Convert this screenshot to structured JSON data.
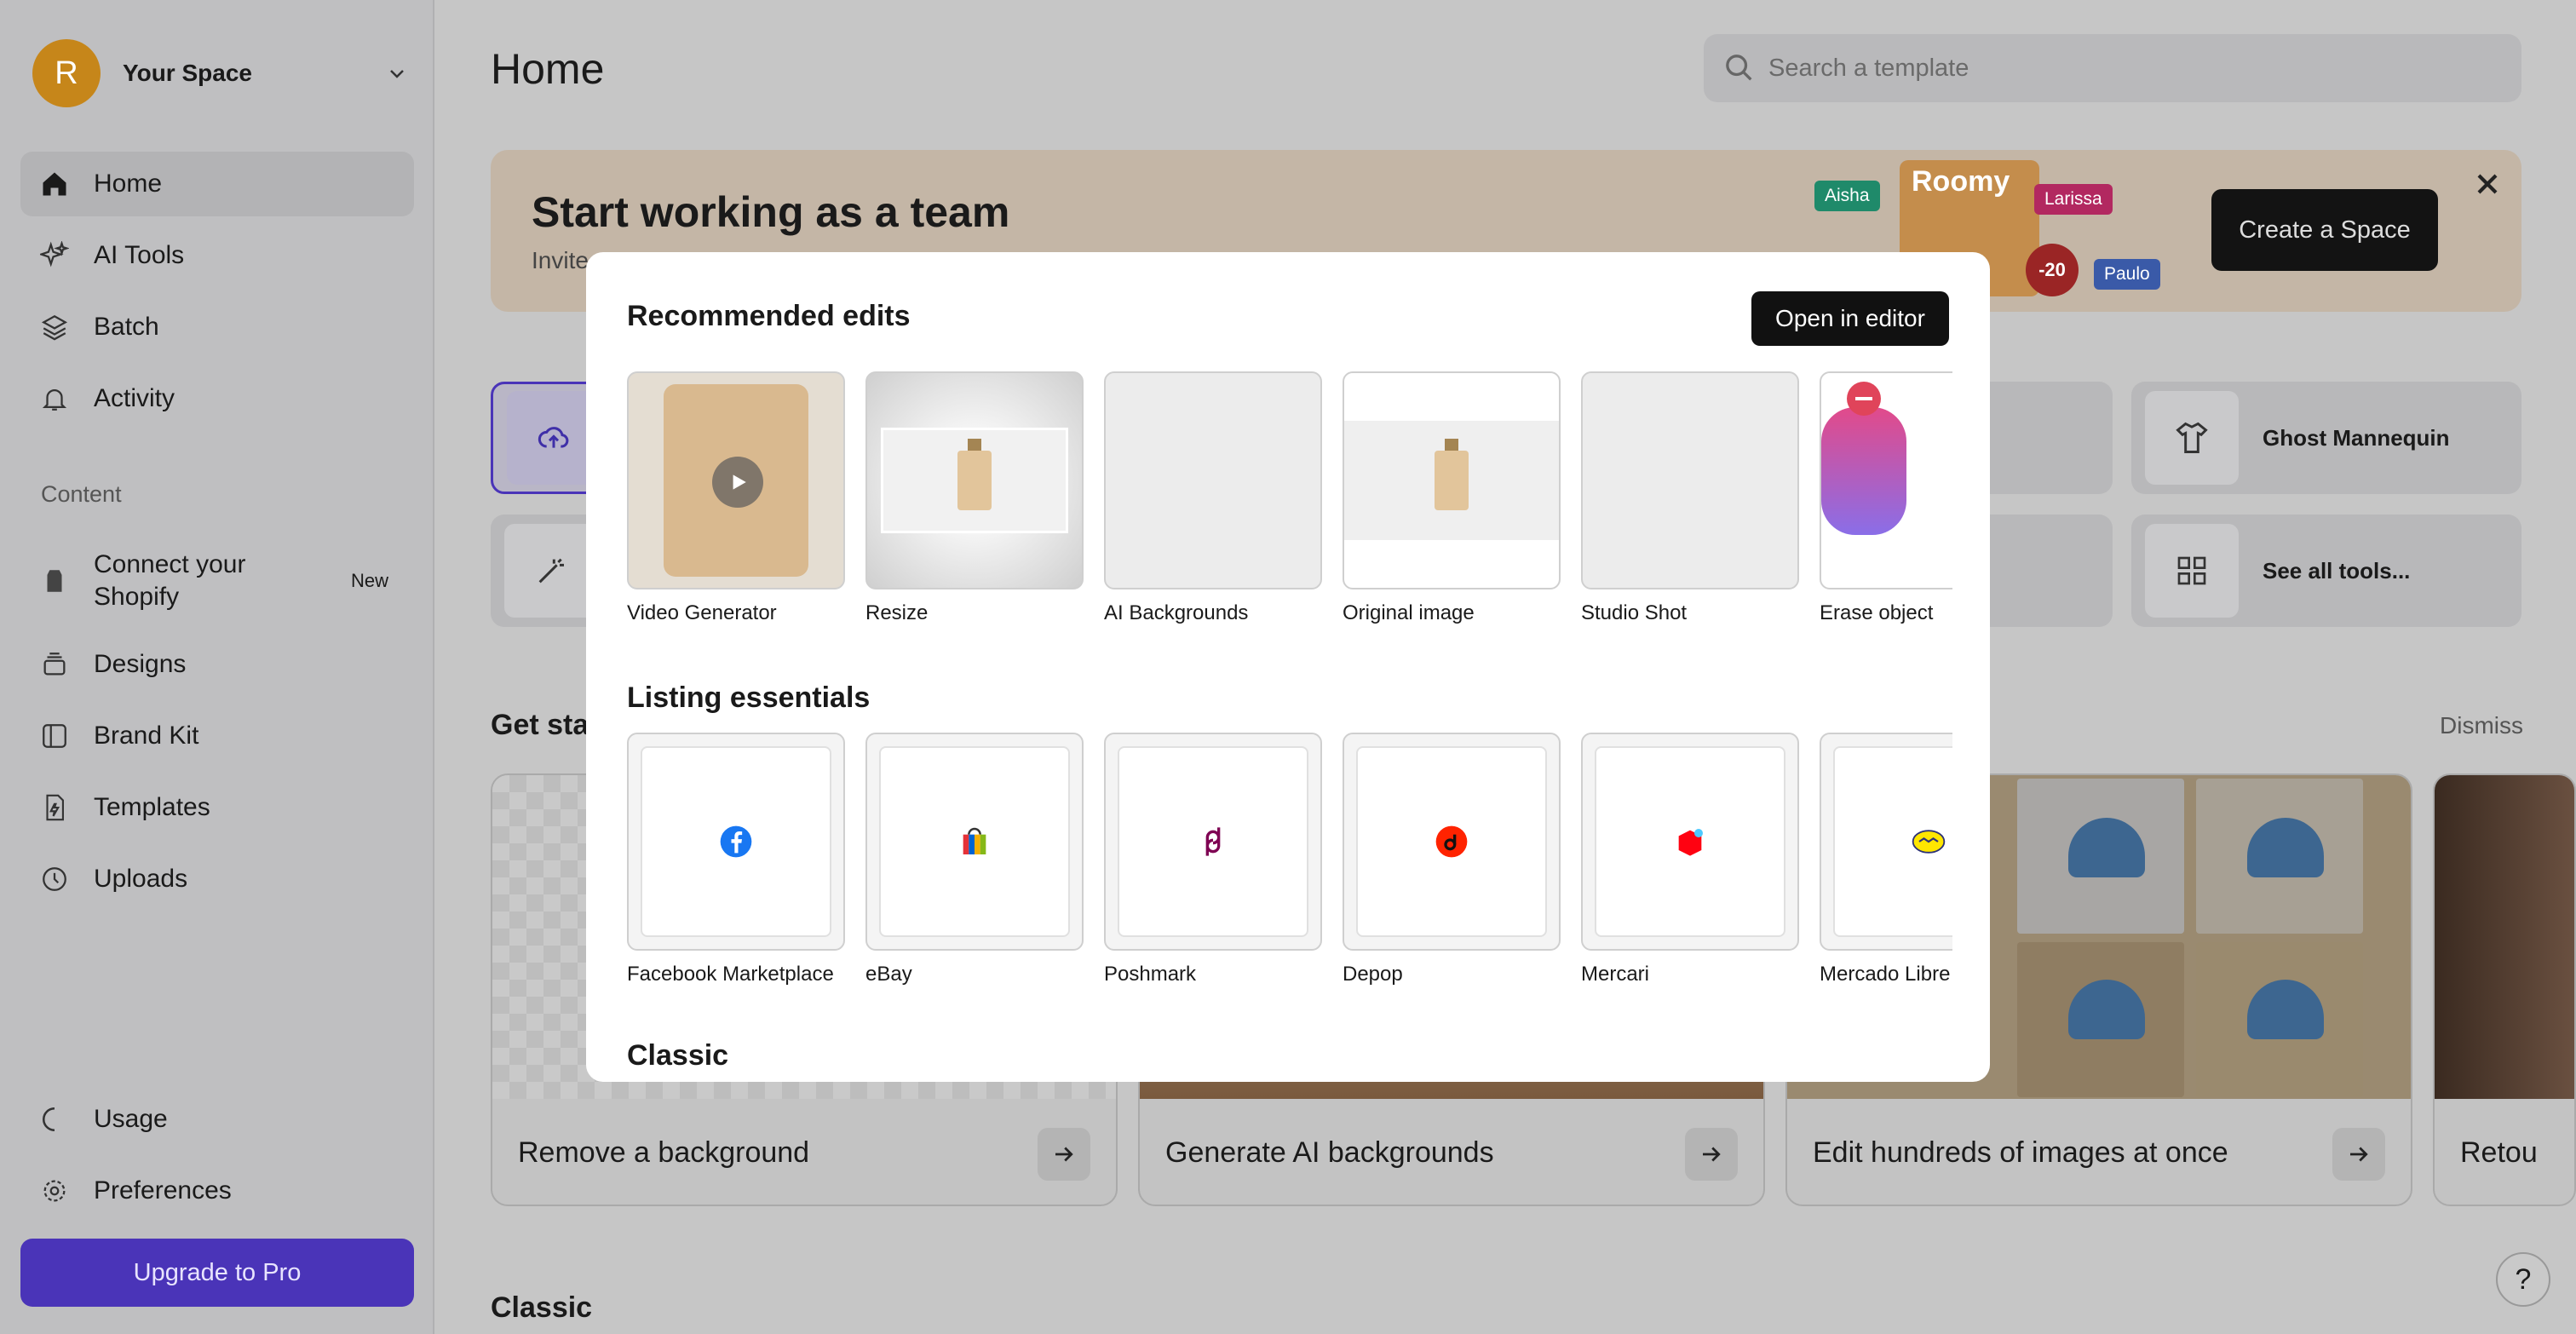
{
  "sidebar": {
    "avatar_letter": "R",
    "space_name": "Your Space",
    "nav": [
      {
        "label": "Home",
        "icon": "home-icon"
      },
      {
        "label": "AI Tools",
        "icon": "sparkles-icon"
      },
      {
        "label": "Batch",
        "icon": "layers-icon"
      },
      {
        "label": "Activity",
        "icon": "bell-icon"
      }
    ],
    "content_label": "Content",
    "content_nav": [
      {
        "label": "Connect your Shopify",
        "badge": "New",
        "icon": "shopify-icon"
      },
      {
        "label": "Designs",
        "icon": "stack-icon"
      },
      {
        "label": "Brand Kit",
        "icon": "brand-kit-icon"
      },
      {
        "label": "Templates",
        "icon": "template-icon"
      },
      {
        "label": "Uploads",
        "icon": "history-icon"
      }
    ],
    "bottom_nav": [
      {
        "label": "Usage",
        "icon": "circle-icon"
      },
      {
        "label": "Preferences",
        "icon": "gear-icon"
      }
    ],
    "upgrade_label": "Upgrade to Pro"
  },
  "header": {
    "title": "Home",
    "search_placeholder": "Search a template"
  },
  "banner": {
    "title": "Start working as a team",
    "subtitle": "Invite",
    "create_label": "Create a Space",
    "tags": {
      "aisha": "Aisha",
      "larissa": "Larissa",
      "paulo": "Paulo",
      "roomy": "Roomy",
      "sale": "-20"
    }
  },
  "tools": [
    {
      "label": "Ghost Mannequin",
      "icon": "shirt-icon"
    },
    {
      "label": "See all tools...",
      "icon": "grid-icon"
    }
  ],
  "get_started": {
    "title": "Get sta",
    "dismiss": "Dismiss",
    "cards": [
      {
        "label": "Remove a background"
      },
      {
        "label": "Generate AI backgrounds"
      },
      {
        "label": "Edit hundreds of images at once"
      },
      {
        "label": "Retou"
      }
    ]
  },
  "classic_label": "Classic",
  "modal": {
    "recommended_title": "Recommended edits",
    "open_editor": "Open in editor",
    "recommended": [
      {
        "label": "Video Generator"
      },
      {
        "label": "Resize"
      },
      {
        "label": "AI Backgrounds"
      },
      {
        "label": "Original image"
      },
      {
        "label": "Studio Shot"
      },
      {
        "label": "Erase object"
      }
    ],
    "listing_title": "Listing essentials",
    "listing": [
      {
        "label": "Facebook Marketplace",
        "icon": "facebook-icon",
        "color": "#1877f2"
      },
      {
        "label": "eBay",
        "icon": "ebay-icon",
        "color": "#0064d2"
      },
      {
        "label": "Poshmark",
        "icon": "poshmark-icon",
        "color": "#7f0353"
      },
      {
        "label": "Depop",
        "icon": "depop-icon",
        "color": "#ff2300"
      },
      {
        "label": "Mercari",
        "icon": "mercari-icon",
        "color": "#ff0211"
      },
      {
        "label": "Mercado Libre",
        "icon": "mercado-libre-icon",
        "color": "#ffe600"
      }
    ],
    "classic_title": "Classic"
  }
}
